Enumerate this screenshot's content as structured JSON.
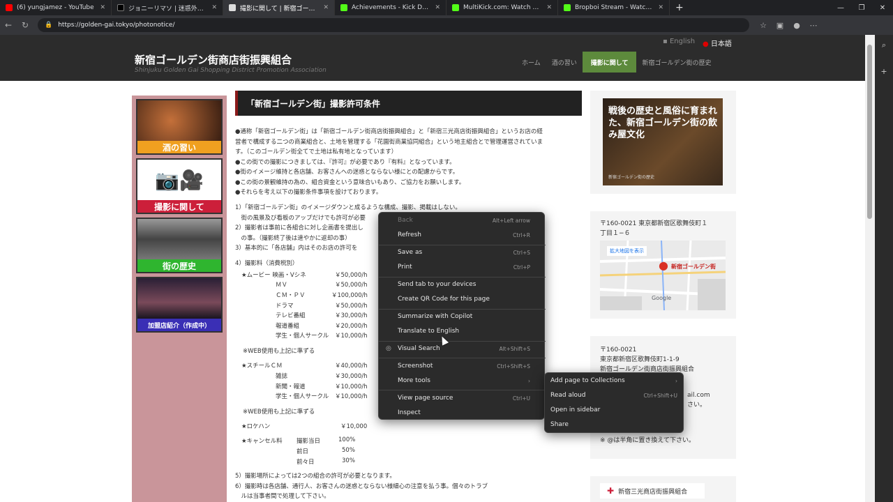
{
  "browser": {
    "tabs": [
      {
        "title": "(6) yungjamez - YouTube",
        "color": "#ff0000"
      },
      {
        "title": "ジョニーリマソ | 迷惑外国人撲滅 (@",
        "color": "#000000"
      },
      {
        "title": "撮影に関して | 新宿ゴールデン街商店",
        "color": "#dddddd",
        "active": true
      },
      {
        "title": "Achievements - Kick Dashboard",
        "color": "#53fc18"
      },
      {
        "title": "MultiKick.com: Watch Multiple Str",
        "color": "#53fc18"
      },
      {
        "title": "Bropboi Stream - Watch Live",
        "color": "#53fc18"
      }
    ],
    "url": "https://golden-gai.tokyo/photonotice/"
  },
  "site": {
    "lang_en": "English",
    "lang_jp": "日本語",
    "title": "新宿ゴールデン街商店街振興組合",
    "subtitle": "Shinjuku Golden Gai Shopping District Promotion Association",
    "nav": [
      "ホーム",
      "酒の習い",
      "撮影に関して",
      "新宿ゴールデン街の歴史"
    ],
    "nav_active_color": "#5d8a3c"
  },
  "sidebar": {
    "items": [
      {
        "label": "酒の習い",
        "color": "#f0a020"
      },
      {
        "label": "撮影に関して",
        "color": "#cc1f3a"
      },
      {
        "label": "街の歴史",
        "color": "#2fb52f"
      },
      {
        "label": "加盟店紹介（作成中）",
        "color": "#3a2fb5"
      }
    ]
  },
  "main": {
    "heading": "「新宿ゴールデン街」撮影許可条件",
    "intro": [
      "●通称「新宿ゴールデン街」は「新宿ゴールデン街商店街振興組合」と「新宿三光商店街振興組合」というお店の経",
      "営者で構成する二つの商業組合と、土地を管理する「花園街商業協同組合」という地主組合とで管理運営されていま",
      "す。（このゴールデン街全てで土地は私有地となっています）",
      "●この街での撮影につきましては、『許可』が必要であり『有料』となっています。",
      "●街のイメージ維持と各店舗、お客さんへの迷惑とならない様にとの配慮からです。",
      "●この街の景観維持の為の、組合資金という意味合いもあり、ご協力をお願いします。",
      "●それらを考え以下の撮影条件事項を設けております。"
    ],
    "rules": [
      "1）「新宿ゴールデン街」のイメージダウンと成るような構成、撮影、掲載はしない。",
      "　街の風景及び看板のアップだけでも許可が必要",
      "2）撮影者は事前に各組合に対し企画書を提出し",
      "　の事。（撮影終了後は速やかに返却の事）",
      "3）基本的に「各店舗」内はそのお店の許可を"
    ],
    "fee_title": "4）撮影料（消費税別）",
    "fees_movie": [
      {
        "name": "★ムービー 映画・Vシネ",
        "price": "￥50,000/h"
      },
      {
        "name": "ＭＶ",
        "price": "￥50,000/h"
      },
      {
        "name": "ＣＭ・ＰＶ",
        "price": "￥100,000/h"
      },
      {
        "name": "ドラマ",
        "price": "￥50,000/h"
      },
      {
        "name": "テレビ番組",
        "price": "￥30,000/h"
      },
      {
        "name": "報道番組",
        "price": "￥20,000/h"
      },
      {
        "name": "学生・個人サークル",
        "price": "￥10,000/h"
      }
    ],
    "web_note_1": "※WEB使用も上記に準ずる",
    "fees_still": [
      {
        "name": "★スチールＣＭ",
        "price": "￥40,000/h"
      },
      {
        "name": "雑誌",
        "price": "￥30,000/h"
      },
      {
        "name": "新聞・報道",
        "price": "￥10,000/h"
      },
      {
        "name": "学生・個人サークル",
        "price": "￥10,000/h"
      }
    ],
    "web_note_2": "※WEB使用も上記に準ずる",
    "location_hunting": {
      "name": "★ロケハン",
      "price": "￥10,000"
    },
    "cancel": {
      "name": "★キャンセル料",
      "rows": [
        {
          "when": "撮影当日",
          "pct": "100%"
        },
        {
          "when": "前日",
          "pct": "50%"
        },
        {
          "when": "前々日",
          "pct": "30%"
        }
      ]
    },
    "footer_rules": [
      "5）撮影場所によっては2つの組合の許可が必要となります。",
      "6）撮影時は各店舗、通行人、お客さんの迷惑とならない様細心の注意を払う事。個々のトラブ",
      "　ルは当事者間で処理して下さい。"
    ]
  },
  "right": {
    "promo_text": "戦後の歴史と風俗に育まれた、新宿ゴールデン街の飲み屋文化",
    "promo_sub": "新宿ゴールデン街の歴史",
    "map_addr_1": "〒160-0021 東京都新宿区歌舞伎町１",
    "map_addr_2": "丁目１−６",
    "map_link": "拡大地図を表示",
    "map_pin_label": "新宿ゴールデン街",
    "map_attr": "Google",
    "addr2": [
      "〒160-0021",
      "東京都新宿区歌舞伎町1-1-9",
      "新宿ゴールデン街商店街振興組合"
    ],
    "mail_frag": "ail.com",
    "mail_frag2": "さい。",
    "at_note": "※ @は半角に置き換えて下さい。",
    "bottom_card": "新宿三光商店街振興組合"
  },
  "context_menu": {
    "items": [
      {
        "label": "Back",
        "shortcut": "Alt+Left arrow",
        "disabled": true
      },
      {
        "label": "Refresh",
        "shortcut": "Ctrl+R"
      },
      {
        "label": "Save as",
        "shortcut": "Ctrl+S"
      },
      {
        "label": "Print",
        "shortcut": "Ctrl+P"
      },
      {
        "label": "Send tab to your devices",
        "shortcut": ""
      },
      {
        "label": "Create QR Code for this page",
        "shortcut": ""
      },
      {
        "label": "Summarize with Copilot",
        "shortcut": ""
      },
      {
        "label": "Translate to English",
        "shortcut": ""
      },
      {
        "label": "Visual Search",
        "shortcut": "Alt+Shift+S"
      },
      {
        "label": "Screenshot",
        "shortcut": "Ctrl+Shift+S"
      },
      {
        "label": "More tools",
        "shortcut": "›"
      },
      {
        "label": "View page source",
        "shortcut": "Ctrl+U"
      },
      {
        "label": "Inspect",
        "shortcut": ""
      }
    ],
    "submenu": [
      {
        "label": "Add page to Collections",
        "shortcut": "›"
      },
      {
        "label": "Read aloud",
        "shortcut": "Ctrl+Shift+U"
      },
      {
        "label": "Open in sidebar",
        "shortcut": ""
      },
      {
        "label": "Share",
        "shortcut": ""
      }
    ]
  }
}
